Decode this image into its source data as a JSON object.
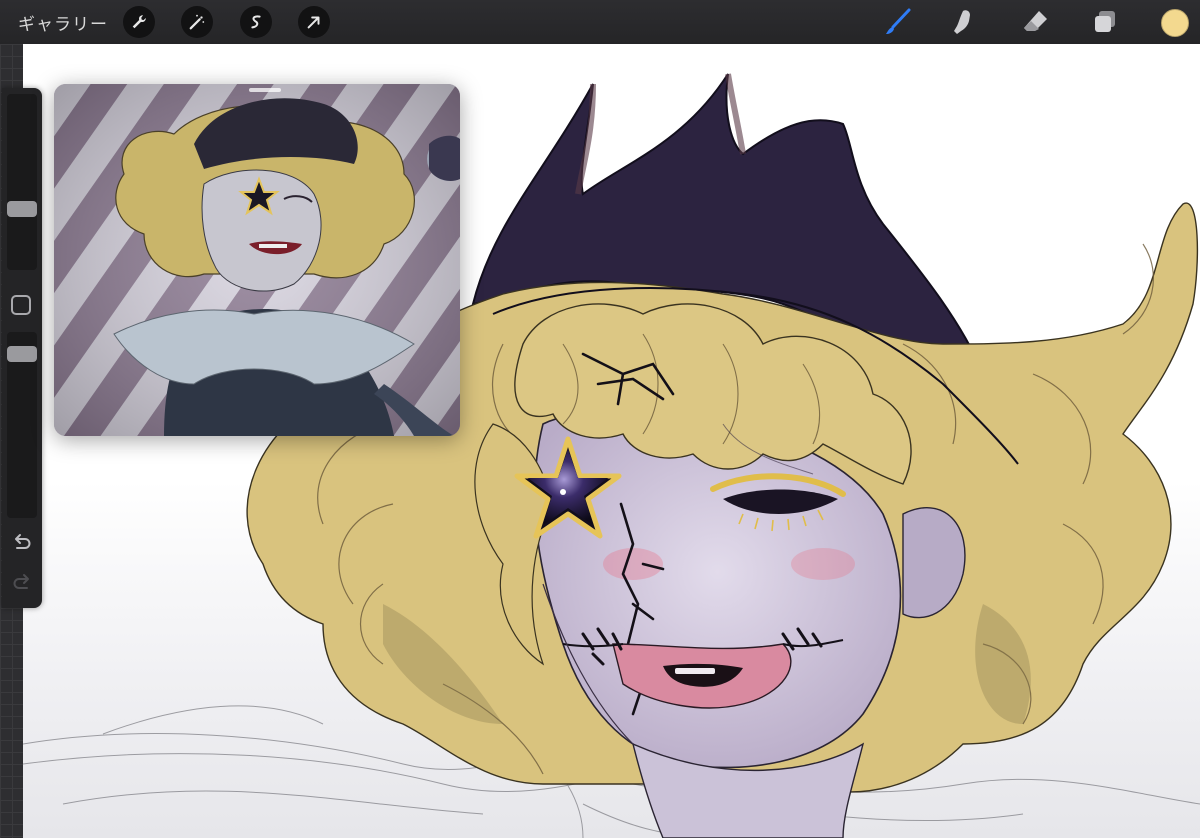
{
  "toolbar": {
    "gallery_label": "ギャラリー",
    "left_tools": [
      "wrench-icon",
      "magic-wand-icon",
      "selection-icon",
      "transform-arrow-icon"
    ],
    "right_tools": [
      "brush-icon",
      "smudge-icon",
      "eraser-icon",
      "layers-icon"
    ],
    "active_tool": "brush-icon",
    "active_tool_color": "#2f7cf6",
    "current_color": "#f3d98f"
  },
  "sidebar": {
    "brush_size_level": 0.3,
    "brush_opacity_level": 0.06,
    "controls": [
      "brush-size-slider",
      "modify-button",
      "brush-opacity-slider",
      "undo-icon",
      "redo-icon"
    ]
  },
  "reference_window": {
    "content": "reference-image-clown-character"
  },
  "canvas": {
    "content": "sketch-clown-portrait"
  }
}
